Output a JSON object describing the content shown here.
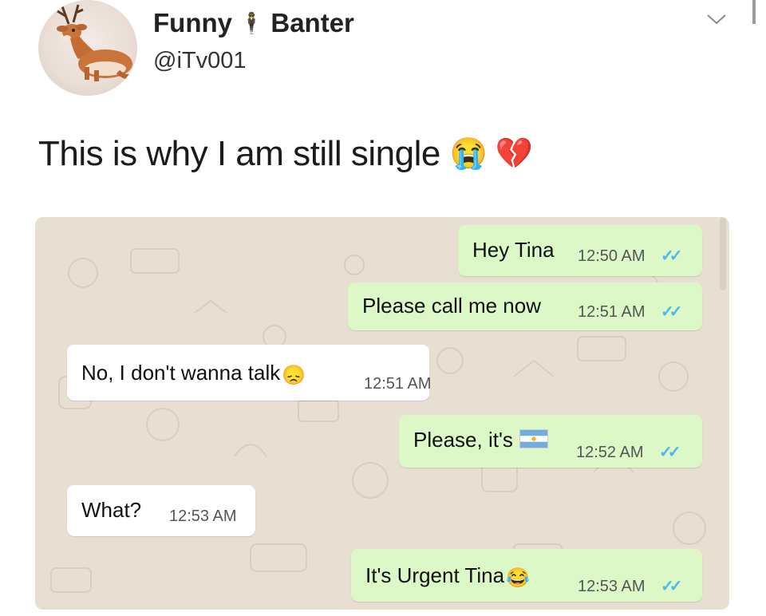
{
  "header": {
    "display_name_left": "Funny",
    "display_name_right": "Banter",
    "name_emoji": "🕴",
    "handle": "@iTv001"
  },
  "tweet": {
    "text": "This is why I am still single",
    "emojis": "😭 💔"
  },
  "chat": {
    "messages": [
      {
        "text": "Hey Tina",
        "time": "12:50 AM",
        "direction": "out",
        "ticks": "✓✓"
      },
      {
        "text": "Please call me now",
        "time": "12:51 AM",
        "direction": "out",
        "ticks": "✓✓"
      },
      {
        "text": "No, I don't wanna talk",
        "emoji": "😞",
        "time": "12:51 AM",
        "direction": "in"
      },
      {
        "text": "Please, it's",
        "time": "12:52 AM",
        "direction": "out",
        "ticks": "✓✓"
      },
      {
        "text": "What?",
        "time": "12:53 AM",
        "direction": "in"
      },
      {
        "text": "It's Urgent Tina",
        "emoji": "😂",
        "time": "12:53 AM",
        "direction": "out",
        "ticks": "✓✓"
      }
    ]
  },
  "colors": {
    "outgoing_bubble": "#dcf8c6",
    "incoming_bubble": "#ffffff",
    "wallpaper": "#e8dfd3",
    "read_ticks": "#4fb6ec"
  },
  "icons": [
    "chevron-down-icon",
    "deer-avatar",
    "read-receipt-icon",
    "argentina-flag-icon"
  ]
}
